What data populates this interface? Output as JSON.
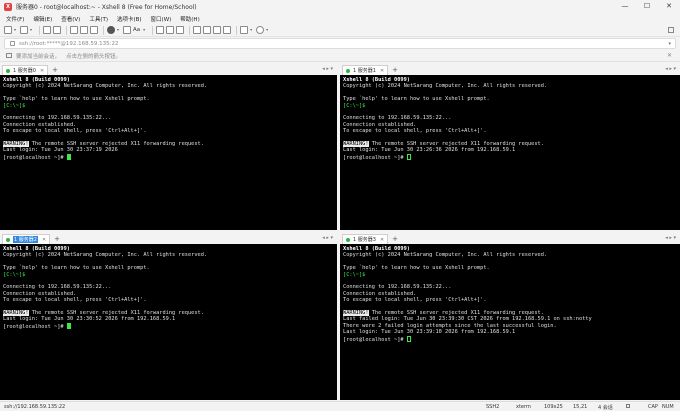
{
  "window": {
    "title": "服务器0 - root@localhost:~ - Xshell 8 (Free for Home/School)",
    "app_icon_glyph": "X",
    "controls": [
      "—",
      "☐",
      "✕"
    ]
  },
  "menu": [
    "文件(F)",
    "编辑(E)",
    "查看(V)",
    "工具(T)",
    "选项卡(B)",
    "窗口(W)",
    "帮助(H)"
  ],
  "toolbar": {
    "font_label": "Aa"
  },
  "address": {
    "text": "ssh://root:*****@192.168.59.135:22",
    "drop": "▾"
  },
  "hint": {
    "text1": "要添加当前会话，",
    "text2": "点击左侧的箭头按钮。",
    "close": "✕"
  },
  "tab_controls": {
    "plus": "+",
    "close": "✕",
    "nav": "◂ ▸ ▾"
  },
  "panes": [
    {
      "tab_label": "1 服务器0",
      "tab_highlight": false,
      "lines": [
        [
          {
            "t": "Xshell 8 (Build 0099)",
            "c": "bold"
          }
        ],
        [
          {
            "t": "Copyright (c) 2024 NetSarang Computer, Inc. All rights reserved."
          }
        ],
        [
          {
            "t": ""
          }
        ],
        [
          {
            "t": "Type `help' to learn how to use Xshell prompt."
          }
        ],
        [
          {
            "t": "[C:\\~]$",
            "c": "green"
          }
        ],
        [
          {
            "t": ""
          }
        ],
        [
          {
            "t": "Connecting to 192.168.59.135:22..."
          }
        ],
        [
          {
            "t": "Connection established."
          }
        ],
        [
          {
            "t": "To escape to local shell, press 'Ctrl+Alt+]'."
          }
        ],
        [
          {
            "t": ""
          }
        ],
        [
          {
            "t": "WARNING!",
            "c": "warn"
          },
          {
            "t": " The remote SSH server rejected X11 forwarding request."
          }
        ],
        [
          {
            "t": "Last login: Tue Jun 30 23:37:19 2026"
          }
        ],
        [
          {
            "t": "[root@localhost ~]# "
          },
          {
            "cursor": "filled"
          }
        ]
      ]
    },
    {
      "tab_label": "1 服务器1",
      "tab_highlight": false,
      "lines": [
        [
          {
            "t": "Xshell 8 (Build 0099)",
            "c": "bold"
          }
        ],
        [
          {
            "t": "Copyright (c) 2024 NetSarang Computer, Inc. All rights reserved."
          }
        ],
        [
          {
            "t": ""
          }
        ],
        [
          {
            "t": "Type `help' to learn how to use Xshell prompt."
          }
        ],
        [
          {
            "t": "[C:\\~]$",
            "c": "green"
          }
        ],
        [
          {
            "t": ""
          }
        ],
        [
          {
            "t": "Connecting to 192.168.59.135:22..."
          }
        ],
        [
          {
            "t": "Connection established."
          }
        ],
        [
          {
            "t": "To escape to local shell, press 'Ctrl+Alt+]'."
          }
        ],
        [
          {
            "t": ""
          }
        ],
        [
          {
            "t": "WARNING!",
            "c": "warn"
          },
          {
            "t": " The remote SSH server rejected X11 forwarding request."
          }
        ],
        [
          {
            "t": "Last login: Tue Jun 30 23:26:36 2026 from 192.168.59.1"
          }
        ],
        [
          {
            "t": "[root@localhost ~]# "
          },
          {
            "cursor": "hollow"
          }
        ]
      ]
    },
    {
      "tab_label": "1 服务器2",
      "tab_highlight": true,
      "lines": [
        [
          {
            "t": "Xshell 8 (Build 0099)",
            "c": "bold"
          }
        ],
        [
          {
            "t": "Copyright (c) 2024 NetSarang Computer, Inc. All rights reserved."
          }
        ],
        [
          {
            "t": ""
          }
        ],
        [
          {
            "t": "Type `help' to learn how to use Xshell prompt."
          }
        ],
        [
          {
            "t": "[C:\\~]$",
            "c": "green"
          }
        ],
        [
          {
            "t": ""
          }
        ],
        [
          {
            "t": "Connecting to 192.168.59.135:22..."
          }
        ],
        [
          {
            "t": "Connection established."
          }
        ],
        [
          {
            "t": "To escape to local shell, press 'Ctrl+Alt+]'."
          }
        ],
        [
          {
            "t": ""
          }
        ],
        [
          {
            "t": "WARNING!",
            "c": "warn"
          },
          {
            "t": " The remote SSH server rejected X11 forwarding request."
          }
        ],
        [
          {
            "t": "Last login: Tue Jun 30 23:30:52 2026 from 192.168.59.1"
          }
        ],
        [
          {
            "t": "[root@localhost ~]# "
          },
          {
            "cursor": "filled"
          }
        ]
      ]
    },
    {
      "tab_label": "1 服务器3",
      "tab_highlight": false,
      "lines": [
        [
          {
            "t": "Xshell 8 (Build 0099)",
            "c": "bold"
          }
        ],
        [
          {
            "t": "Copyright (c) 2024 NetSarang Computer, Inc. All rights reserved."
          }
        ],
        [
          {
            "t": ""
          }
        ],
        [
          {
            "t": "Type `help' to learn how to use Xshell prompt."
          }
        ],
        [
          {
            "t": "[C:\\~]$",
            "c": "green"
          }
        ],
        [
          {
            "t": ""
          }
        ],
        [
          {
            "t": "Connecting to 192.168.59.135:22..."
          }
        ],
        [
          {
            "t": "Connection established."
          }
        ],
        [
          {
            "t": "To escape to local shell, press 'Ctrl+Alt+]'."
          }
        ],
        [
          {
            "t": ""
          }
        ],
        [
          {
            "t": "WARNING!",
            "c": "warn"
          },
          {
            "t": " The remote SSH server rejected X11 forwarding request."
          }
        ],
        [
          {
            "t": "Last failed login: Tue Jun 30 23:39:30 CST 2026 from 192.168.59.1 on ssh:notty"
          }
        ],
        [
          {
            "t": "There were 2 failed login attempts since the last successful login."
          }
        ],
        [
          {
            "t": "Last login: Tue Jun 30 23:39:10 2026 from 192.168.59.1"
          }
        ],
        [
          {
            "t": "[root@localhost ~]# "
          },
          {
            "cursor": "hollow"
          }
        ]
      ]
    }
  ],
  "status": {
    "connection": "ssh://192.168.59.135:22",
    "protocol": "SSH2",
    "terminal": "xterm",
    "size": "109x25",
    "cursor_pos": "15,21",
    "sessions": "4 会话",
    "caps": "CAP",
    "num": "NUM"
  }
}
